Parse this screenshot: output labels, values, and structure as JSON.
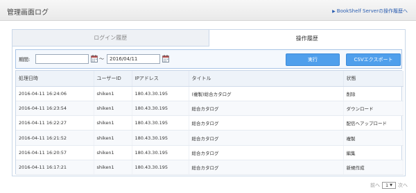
{
  "header": {
    "title": "管理画面ログ",
    "link_label": "BookShelf Serverの操作履歴へ"
  },
  "tabs": [
    {
      "label": "ログイン履歴",
      "active": false
    },
    {
      "label": "操作履歴",
      "active": true
    }
  ],
  "filter": {
    "label": "期間:",
    "from_value": "",
    "separator": "～",
    "to_value": "2016/04/11",
    "run_label": "実行",
    "export_label": "CSVエクスポート"
  },
  "table": {
    "columns": [
      "処理日時",
      "ユーザーID",
      "IPアドレス",
      "タイトル",
      "状態"
    ],
    "rows": [
      [
        "2016-04-11 16:24:06",
        "shiken1",
        "180.43.30.195",
        "(複製)総合カタログ",
        "削除"
      ],
      [
        "2016-04-11 16:23:54",
        "shiken1",
        "180.43.30.195",
        "総合カタログ",
        "ダウンロード"
      ],
      [
        "2016-04-11 16:22:27",
        "shiken1",
        "180.43.30.195",
        "総合カタログ",
        "配信へアップロード"
      ],
      [
        "2016-04-11 16:21:52",
        "shiken1",
        "180.43.30.195",
        "総合カタログ",
        "複製"
      ],
      [
        "2016-04-11 16:20:57",
        "shiken1",
        "180.43.30.195",
        "総合カタログ",
        "編集"
      ],
      [
        "2016-04-11 16:17:21",
        "shiken1",
        "180.43.30.195",
        "総合カタログ",
        "新規作成"
      ]
    ]
  },
  "pager": {
    "prev_label": "前へ",
    "page_value": "1",
    "next_label": "次へ"
  },
  "colors": {
    "accent": "#4f9fec",
    "link": "#2a5db0"
  },
  "icons": {
    "calendar": "calendar-icon",
    "link_arrow": "chevron-right-icon"
  }
}
